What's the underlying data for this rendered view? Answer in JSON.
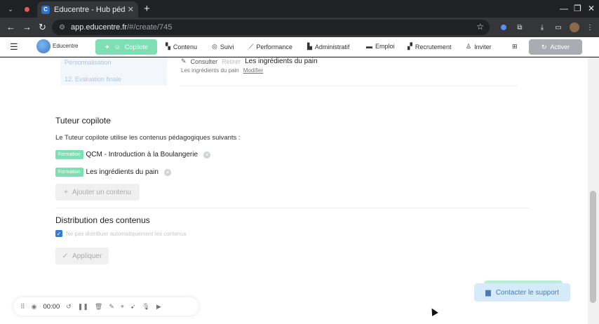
{
  "browser": {
    "tab_title": "Educentre - Hub pédago",
    "tab_favicon_letter": "C",
    "url_host": "app.educentre.fr",
    "url_path": "/#/create/745"
  },
  "appbar": {
    "brand": "Educentre",
    "copilote_label": "Copilote",
    "nav": [
      {
        "label": "Contenu",
        "icon": "content-icon"
      },
      {
        "label": "Suivi",
        "icon": "check-circle-icon"
      },
      {
        "label": "Performance",
        "icon": "chart-icon"
      },
      {
        "label": "Administratif",
        "icon": "document-icon"
      },
      {
        "label": "Emploi",
        "icon": "briefcase-icon"
      },
      {
        "label": "Recrutement",
        "icon": "people-icon"
      },
      {
        "label": "Inviter",
        "icon": "add-user-icon"
      }
    ],
    "activer_label": "Activer"
  },
  "sidebar_fragment": {
    "item1": "Personnalisation",
    "item2": "12. Evaluation finale"
  },
  "content_top": {
    "consulter": "Consulter",
    "retirer": "Retirer",
    "title": "Les ingrédients du pain",
    "sub_label": "Les ingrédients du pain",
    "modifier": "Modifier"
  },
  "tuteur": {
    "title": "Tuteur copilote",
    "description": "Le Tuteur copilote utilise les contenus pédagogiques suivants :",
    "items": [
      {
        "badge": "Formation",
        "name": "QCM - Introduction à la Boulangerie"
      },
      {
        "badge": "Formation",
        "name": "Les ingrédients du pain"
      }
    ],
    "add_label": "Ajouter un contenu"
  },
  "distribution": {
    "title": "Distribution des contenus",
    "checkbox_label": "Ne pas distribuer automatiquement les contenus",
    "apply_label": "Appliquer"
  },
  "support": {
    "label": "Contacter le support"
  },
  "recorder": {
    "time": "00:00"
  }
}
